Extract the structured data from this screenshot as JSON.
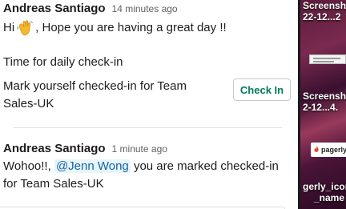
{
  "messages": [
    {
      "author": "Andreas Santiago",
      "time": "14 minutes ago",
      "greeting_prefix": "Hi",
      "greeting_suffix": ", Hope you are having a great day !!",
      "checkin_line": "Time for daily check-in",
      "mark_text": "Mark yourself checked-in for Team Sales-UK",
      "button_label": "Check In"
    },
    {
      "author": "Andreas Santiago",
      "time": "1 minute ago",
      "prefix": "Wohoo!!,",
      "mention": "@Jenn Wong",
      "suffix": "you are marked checked-in for Team Sales-UK"
    }
  ],
  "desktop": {
    "files": [
      {
        "line1": "Screensh",
        "line2": "22-12...2"
      },
      {
        "line1": "Screensh",
        "line2": "2-12...4."
      },
      {
        "line1": "gerly_icon",
        "line2": "_name"
      }
    ],
    "pagerly_label": "pagerly"
  },
  "colors": {
    "button_text": "#007a5a",
    "mention_text": "#1264a3",
    "mention_bg": "#e8f5fa"
  }
}
